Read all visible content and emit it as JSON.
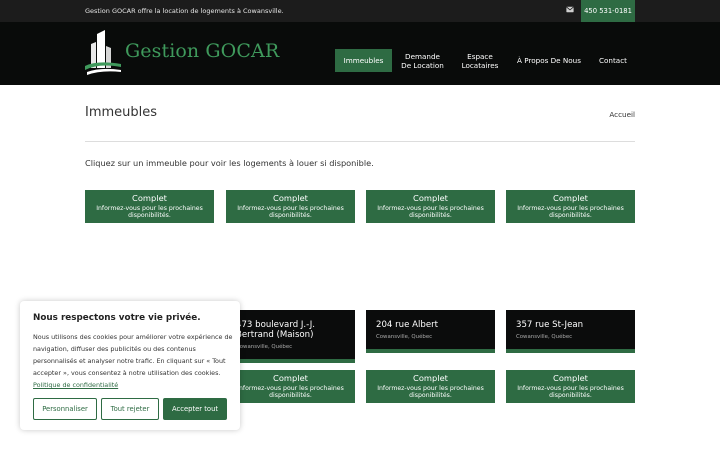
{
  "topbar": {
    "message": "Gestion GOCAR offre la location de logements à Cowansville.",
    "phone": "450 531-0181",
    "mail_icon": "envelope-icon"
  },
  "header": {
    "logo_text": "Gestion GOCAR",
    "logo_icon": "building-logo-icon"
  },
  "nav": {
    "items": [
      {
        "line1": "Immeubles",
        "line2": ""
      },
      {
        "line1": "Demande",
        "line2": "De Location"
      },
      {
        "line1": "Espace",
        "line2": "Locataires"
      },
      {
        "line1": "À Propos De Nous",
        "line2": ""
      },
      {
        "line1": "Contact",
        "line2": ""
      }
    ],
    "active": "Immeubles"
  },
  "page": {
    "title": "Immeubles",
    "breadcrumb": "Accueil",
    "intro": "Cliquez sur un immeuble pour voir les logements à louer si disponible."
  },
  "status_cards": {
    "status": "Complet",
    "note_line1": "Informez-vous pour les prochaines",
    "note_line2": "disponibilités."
  },
  "buildings": [
    {
      "address_line1": "473 boulevard J.-J.",
      "address_line2": "Bertrand (Maison)",
      "city": "Cowansville, Québec"
    },
    {
      "address_line1": "204 rue Albert",
      "address_line2": "",
      "city": "Cowansville, Québec"
    },
    {
      "address_line1": "357 rue St-Jean",
      "address_line2": "",
      "city": "Cowansville, Québec"
    }
  ],
  "cookie_banner": {
    "title": "Nous respectons votre vie privée.",
    "text": "Nous utilisons des cookies pour améliorer votre expérience de navigation, diffuser des publicités ou des contenus personnalisés et analyser notre trafic. En cliquant sur « Tout accepter », vous consentez à notre utilisation des cookies.",
    "policy_link": "Politique de confidentialité",
    "btn_customize": "Personnaliser",
    "btn_reject": "Tout rejeter",
    "btn_accept": "Accepter tout"
  },
  "colors": {
    "accent_green": "#2e6b43",
    "header_bg": "#090b0a",
    "topbar_bg": "#1c1c1c"
  }
}
